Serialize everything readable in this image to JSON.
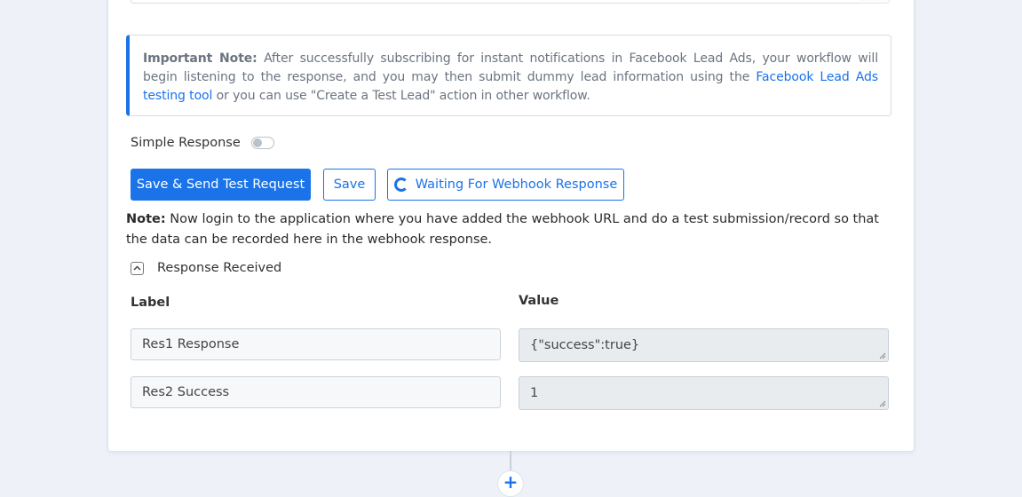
{
  "important_note": {
    "label": "Important Note:",
    "text_before_link": " After successfully subscribing for instant notifications in Facebook Lead Ads, your workflow will begin listening to the response, and you may then submit dummy lead information using the ",
    "link_text": "Facebook Lead Ads testing tool",
    "text_after_link": " or you can use \"Create a Test Lead\" action in other workflow.",
    "accent_color": "#1a73e8"
  },
  "simple_response": {
    "label": "Simple Response",
    "enabled": false
  },
  "buttons": {
    "save_send": "Save & Send Test Request",
    "save": "Save",
    "waiting": "Waiting For Webhook Response"
  },
  "note": {
    "label": "Note:",
    "text": " Now login to the application where you have added the webhook URL and do a test submission/record so that the data can be recorded here in the webhook response."
  },
  "response_received": {
    "label": "Response Received",
    "icon": "chevron-up-icon"
  },
  "table": {
    "label_header": "Label",
    "value_header": "Value",
    "rows": [
      {
        "label": "Res1 Response",
        "value": "{\"success\":true}"
      },
      {
        "label": "Res2 Success",
        "value": "1"
      }
    ]
  },
  "add_step": {
    "symbol": "+"
  }
}
